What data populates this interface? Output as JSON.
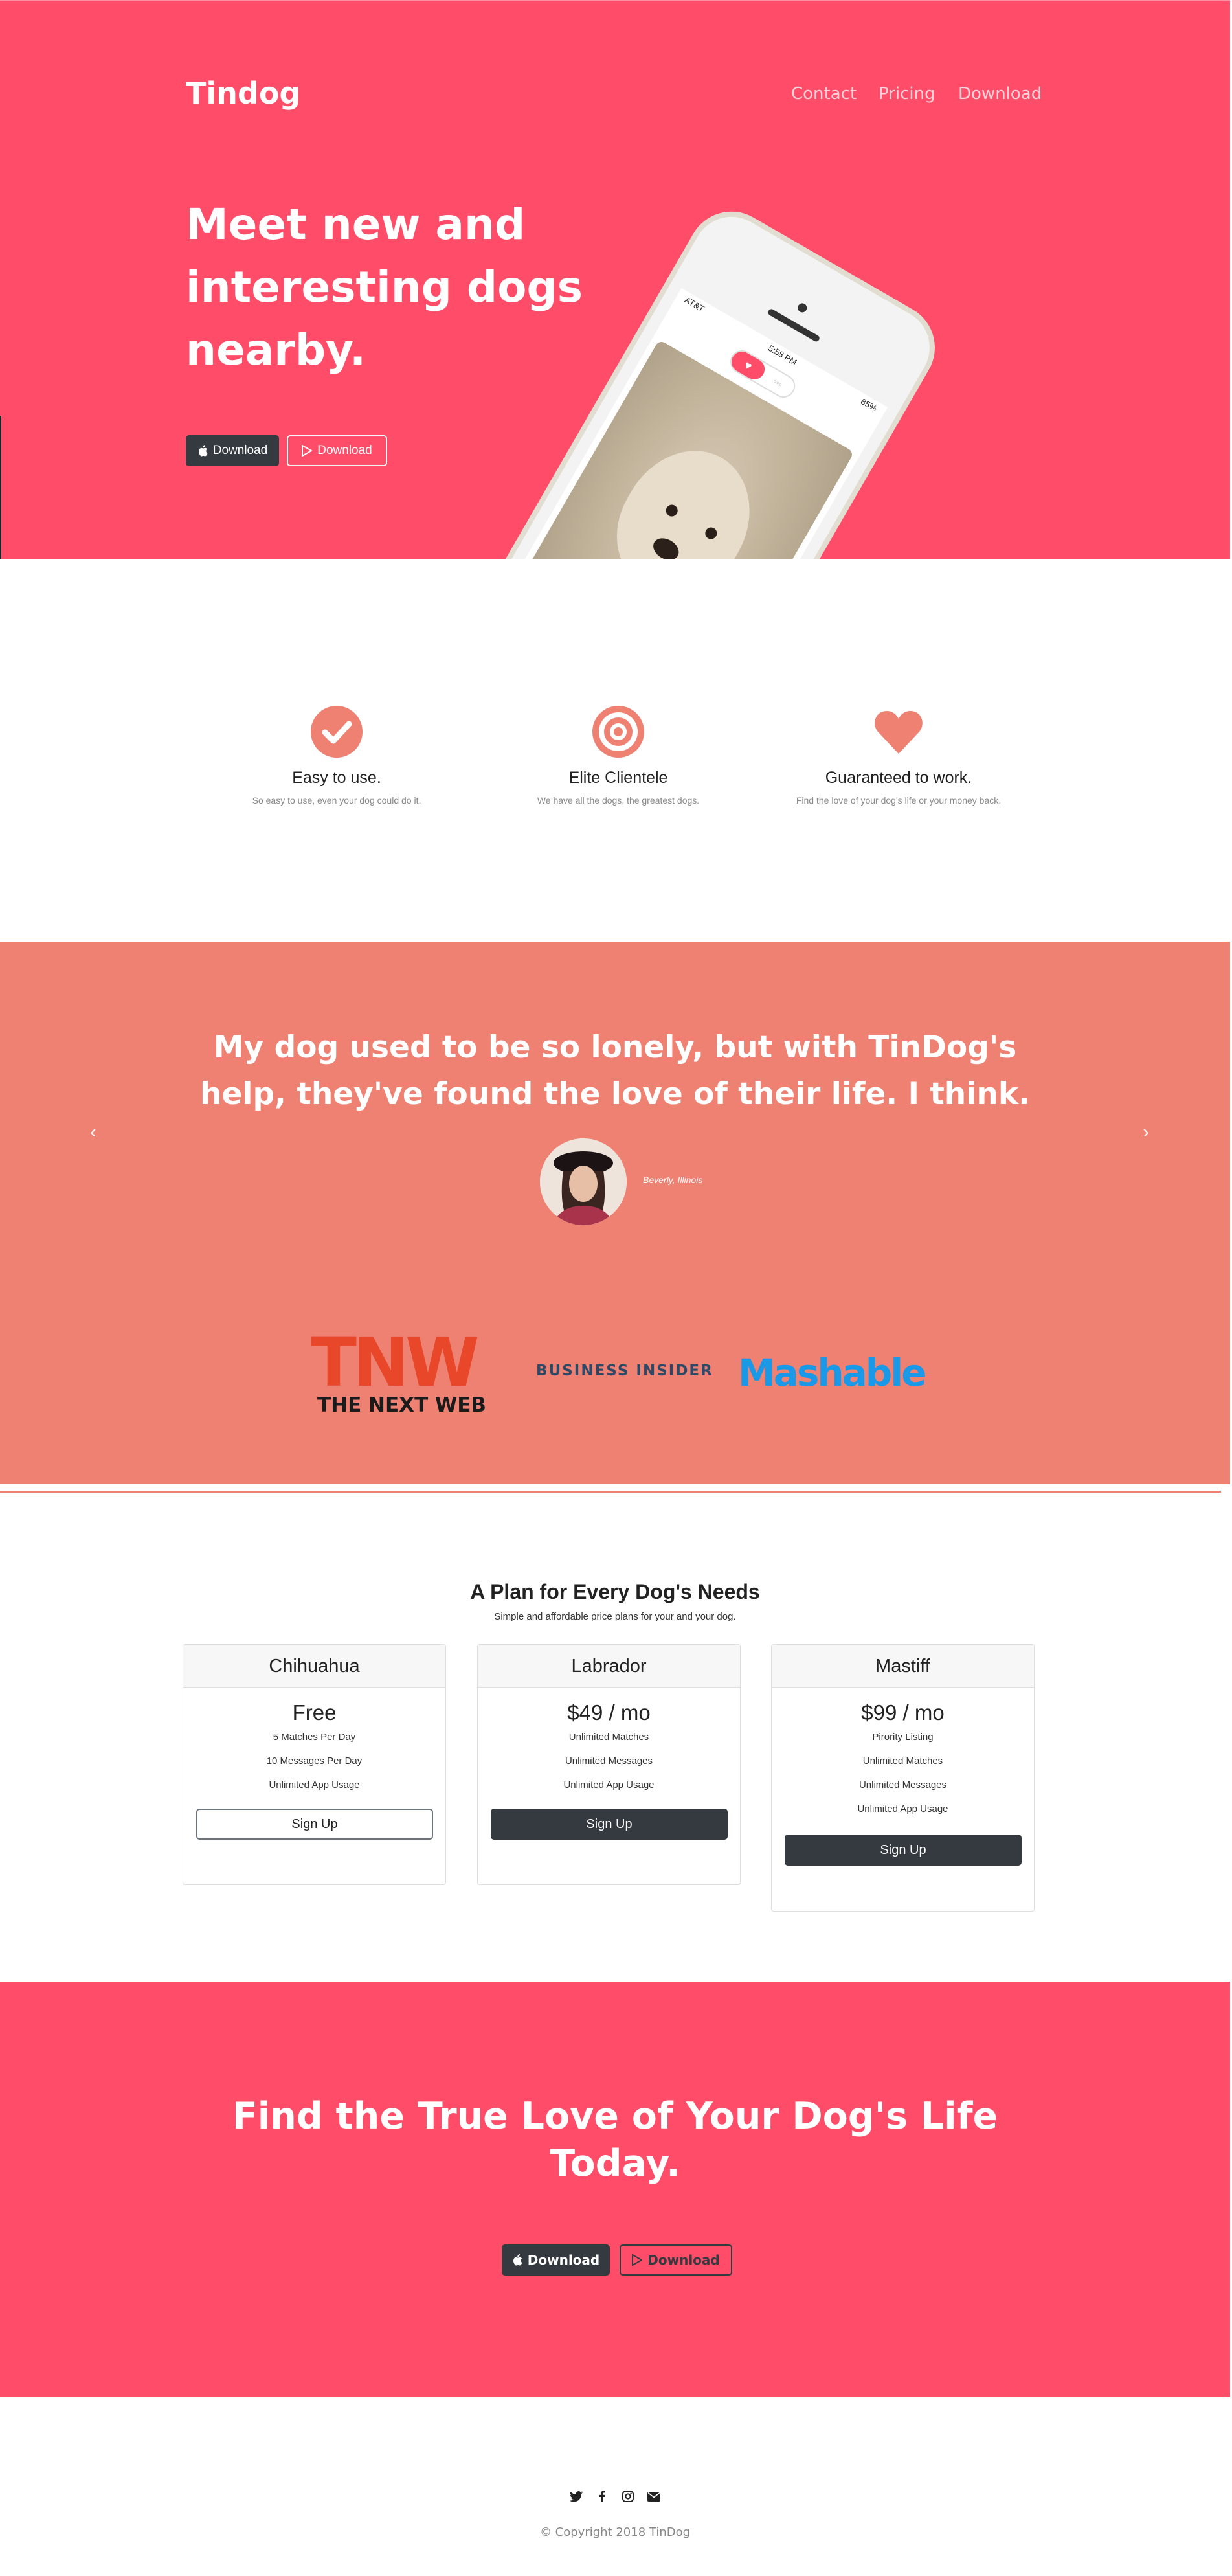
{
  "nav": {
    "brand": "Tindog",
    "links": [
      "Contact",
      "Pricing",
      "Download"
    ]
  },
  "hero": {
    "title": "Meet new and interesting dogs nearby.",
    "buttons": [
      {
        "label": "Download",
        "icon": "apple-icon"
      },
      {
        "label": "Download",
        "icon": "google-play-icon"
      }
    ],
    "phone": {
      "carrier": "AT&T",
      "time": "5:58 PM",
      "battery": "85%"
    }
  },
  "features": [
    {
      "icon": "check-circle-icon",
      "title": "Easy to use.",
      "text": "So easy to use, even your dog could do it."
    },
    {
      "icon": "bullseye-icon",
      "title": "Elite Clientele",
      "text": "We have all the dogs, the greatest dogs."
    },
    {
      "icon": "heart-icon",
      "title": "Guaranteed to work.",
      "text": "Find the love of your dog's life or your money back."
    }
  ],
  "testimonial": {
    "quote": "My dog used to be so lonely, but with TinDog's help, they've found the love of their life. I think.",
    "caption": "Beverly, Illinois"
  },
  "press": {
    "tnw": "THE NEXT WEB",
    "tnw_mark": "TNW",
    "business_insider": "BUSINESS INSIDER",
    "mashable": "Mashable"
  },
  "pricing": {
    "title": "A Plan for Every Dog's Needs",
    "subtitle": "Simple and affordable price plans for your and your dog.",
    "plans": [
      {
        "name": "Chihuahua",
        "price": "Free",
        "features": [
          "5 Matches Per Day",
          "10 Messages Per Day",
          "Unlimited App Usage"
        ],
        "button": "Sign Up"
      },
      {
        "name": "Labrador",
        "price": "$49 / mo",
        "features": [
          "Unlimited Matches",
          "Unlimited Messages",
          "Unlimited App Usage"
        ],
        "button": "Sign Up"
      },
      {
        "name": "Mastiff",
        "price": "$99 / mo",
        "features": [
          "Pirority Listing",
          "Unlimited Matches",
          "Unlimited Messages",
          "Unlimited App Usage"
        ],
        "button": "Sign Up"
      }
    ]
  },
  "cta": {
    "title": "Find the True Love of Your Dog's Life Today.",
    "buttons": [
      {
        "label": "Download",
        "icon": "apple-icon"
      },
      {
        "label": "Download",
        "icon": "google-play-icon"
      }
    ]
  },
  "footer": {
    "social": [
      "twitter-icon",
      "facebook-icon",
      "instagram-icon",
      "envelope-icon"
    ],
    "copyright": "© Copyright 2018 TinDog"
  },
  "colors": {
    "primary": "#ff4c68",
    "secondary": "#ef8172",
    "dark": "#343a40"
  }
}
